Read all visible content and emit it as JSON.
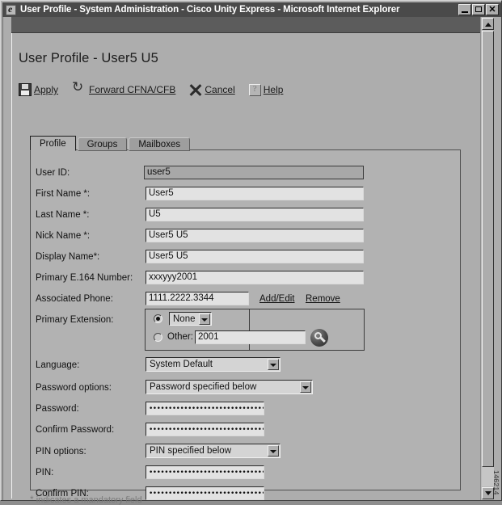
{
  "window": {
    "title": "User Profile - System Administration - Cisco Unity Express - Microsoft Internet Explorer",
    "app_icon": "ie-icon",
    "buttons": {
      "minimize": "_",
      "maximize": "□",
      "close": "✕"
    }
  },
  "page": {
    "heading": "User Profile - User5 U5",
    "mandatory_note": "indicates a mandatory field",
    "mandatory_star": "*",
    "watermark": "146214"
  },
  "actions": [
    {
      "label": "Apply",
      "icon": "save-icon"
    },
    {
      "label": "Forward CFNA/CFB",
      "icon": "forward-icon"
    },
    {
      "label": "Cancel",
      "icon": "cancel-icon"
    },
    {
      "label": "Help",
      "icon": "help-icon"
    }
  ],
  "tabs": [
    {
      "label": "Profile",
      "active": true
    },
    {
      "label": "Groups",
      "active": false
    },
    {
      "label": "Mailboxes",
      "active": false
    }
  ],
  "fields": {
    "user_id": {
      "label": "User ID:",
      "value": "user5"
    },
    "first_name": {
      "label": "First Name *:",
      "value": "User5"
    },
    "last_name": {
      "label": "Last Name *:",
      "value": "U5"
    },
    "nick_name": {
      "label": "Nick Name *:",
      "value": "User5 U5"
    },
    "display_name": {
      "label": "Display Name*:",
      "value": "User5 U5"
    },
    "e164": {
      "label": "Primary E.164 Number:",
      "value": "xxxyyy2001"
    },
    "associated_phone": {
      "label": "Associated Phone:",
      "value": "1111.2222.3344",
      "add_edit_link": "Add/Edit",
      "remove_link": "Remove"
    },
    "primary_extension": {
      "label": "Primary Extension:",
      "none_selected": true,
      "none_value": "None",
      "other_label": "Other:",
      "other_value": "2001",
      "search_icon": "magnifier-icon"
    },
    "language": {
      "label": "Language:",
      "value": "System Default"
    },
    "password_options": {
      "label": "Password options:",
      "value": "Password specified below"
    },
    "password": {
      "label": "Password:",
      "value": "••••••••••••••••••••••••••••••••••"
    },
    "confirm_password": {
      "label": "Confirm Password:",
      "value": "••••••••••••••••••••••••••••••••••"
    },
    "pin_options": {
      "label": "PIN options:",
      "value": "PIN specified below"
    },
    "pin": {
      "label": "PIN:",
      "value": "••••••••••••••••••••••••••••••••••"
    },
    "confirm_pin": {
      "label": "Confirm PIN:",
      "value": "••••••••••••••••••••••••••••••••••"
    }
  },
  "colors": {
    "window_bg": "#adadad",
    "panel_bg": "#b2b2b2",
    "titlebar_bg": "#4a4a4a",
    "input_bg": "#e2e2e2",
    "readonly_bg": "#a8a8a8"
  }
}
